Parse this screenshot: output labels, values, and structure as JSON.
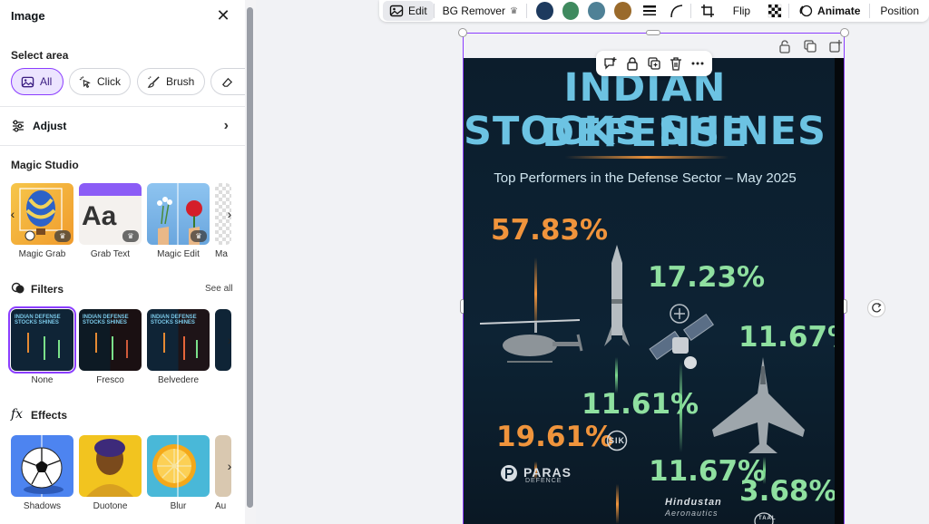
{
  "panel": {
    "title": "Image",
    "select_area": {
      "label": "Select area",
      "buttons": [
        {
          "label": "All",
          "active": true
        },
        {
          "label": "Click"
        },
        {
          "label": "Brush"
        }
      ]
    },
    "adjust": {
      "label": "Adjust"
    },
    "magic_studio": {
      "label": "Magic Studio",
      "items": [
        "Magic Grab",
        "Grab Text",
        "Magic Edit",
        "Ma"
      ]
    },
    "filters": {
      "label": "Filters",
      "see_all": "See all",
      "items": [
        "None",
        "Fresco",
        "Belvedere"
      ]
    },
    "effects": {
      "label": "Effects",
      "items": [
        "Shadows",
        "Duotone",
        "Blur",
        "Au"
      ]
    }
  },
  "toolbar": {
    "edit": "Edit",
    "bg_remover": "BG Remover",
    "swatches": [
      "#1d3a5e",
      "#3f8a5f",
      "#4f8196",
      "#9a6a2b"
    ],
    "flip": "Flip",
    "animate": "Animate",
    "position": "Position"
  },
  "infographic": {
    "title_line1": "INDIAN DEFENSE",
    "title_line2": "STOCKS SHINES",
    "subtitle": "Top Performers in the Defense Sector – May 2025",
    "percentages": [
      "57.83%",
      "17.23%",
      "11.67%",
      "11.61%",
      "19.61%",
      "11.67%",
      "3.68%"
    ],
    "logos": {
      "paras": "PARAS",
      "paras_sub": "DEFENCE",
      "sik": "SIK",
      "hal": "Hindustan",
      "hal_sub": "Aeronautics",
      "taal": "TAAL"
    }
  }
}
